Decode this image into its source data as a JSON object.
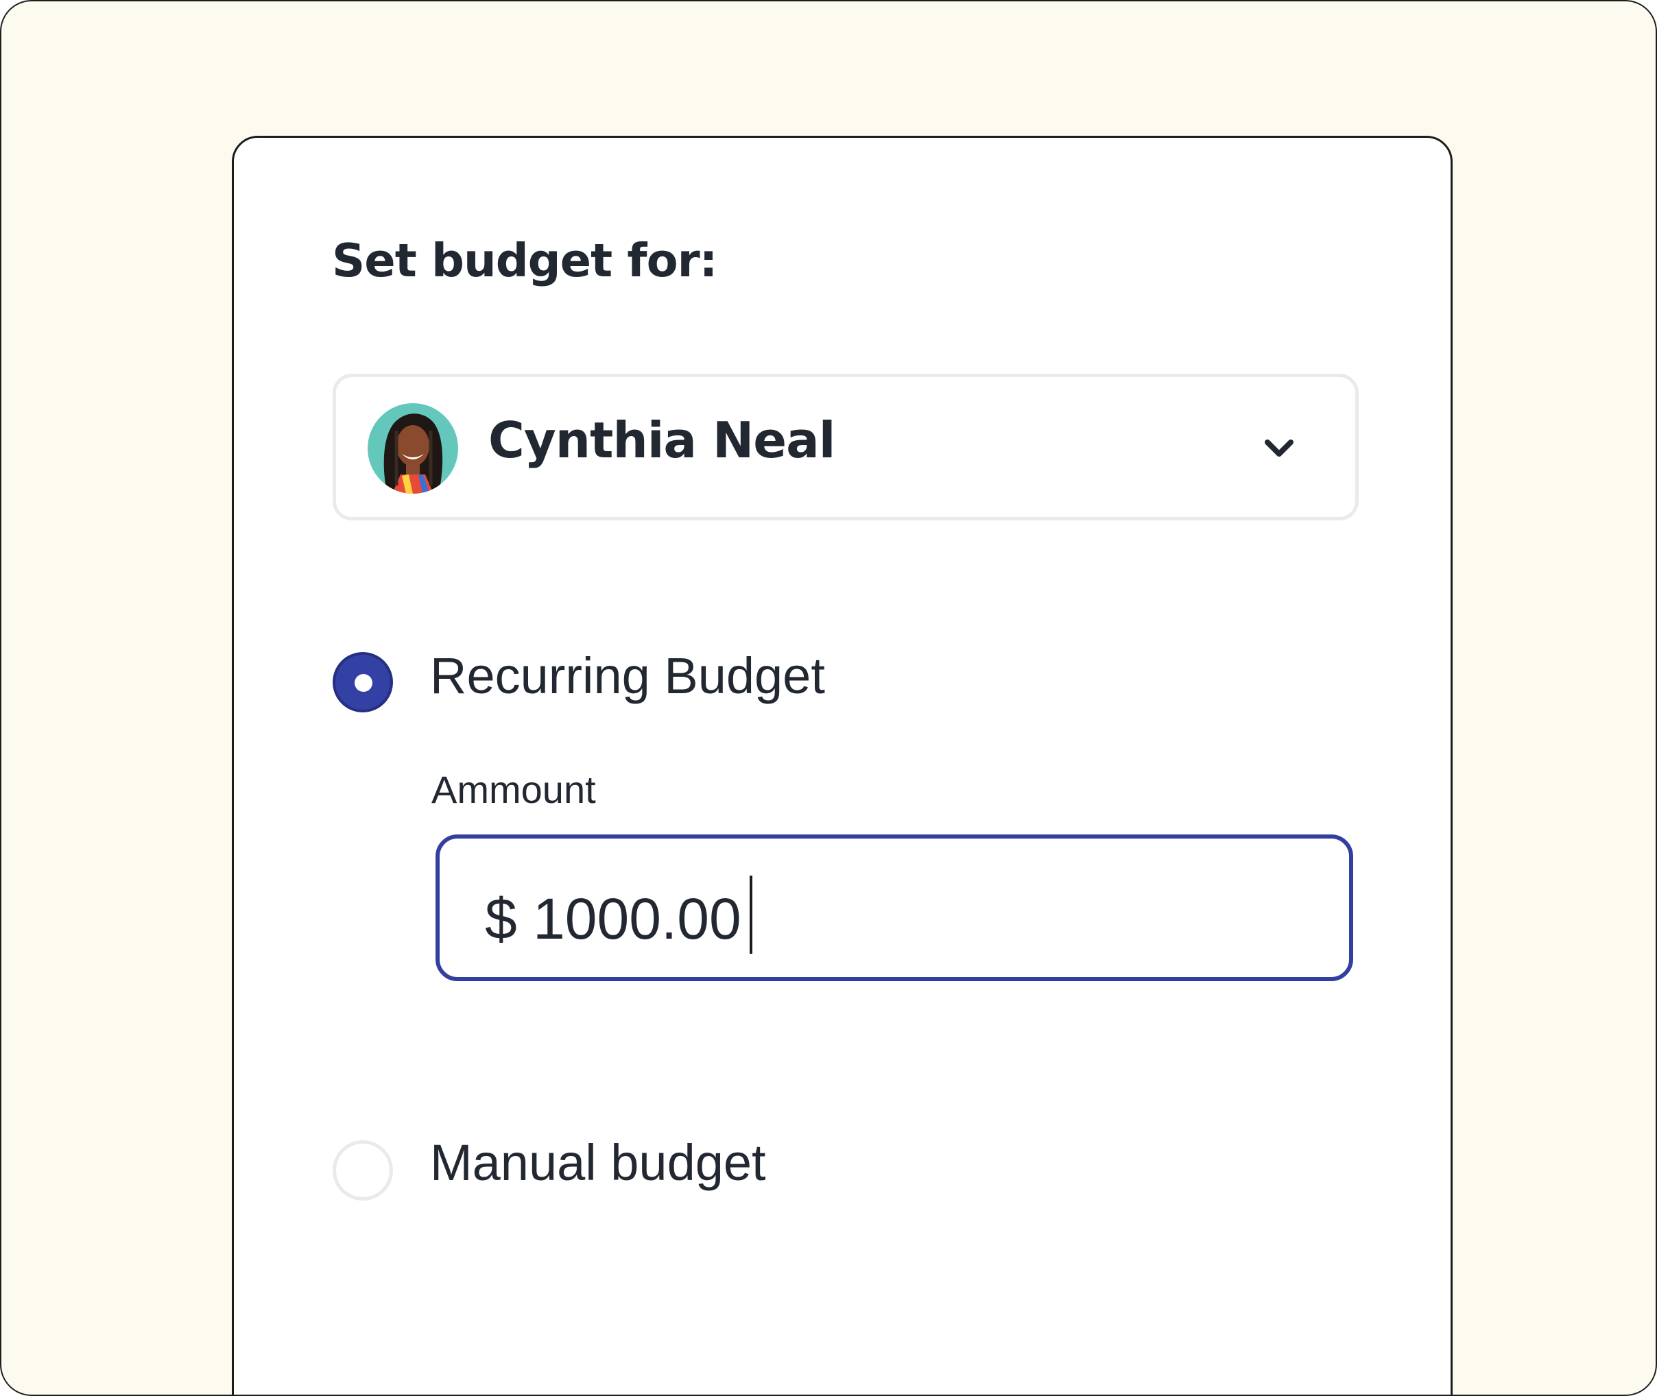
{
  "form": {
    "title": "Set budget for:",
    "selected_person": {
      "name": "Cynthia Neal",
      "avatar_icon": "profile-photo",
      "dropdown_icon": "chevron-down-icon"
    },
    "options": [
      {
        "label": "Recurring Budget",
        "selected": true
      },
      {
        "label": "Manual budget",
        "selected": false
      }
    ],
    "amount": {
      "label": "Ammount",
      "currency_symbol": "$",
      "value": "1000.00"
    }
  },
  "colors": {
    "page_background": "#fdfbf0",
    "card_background": "#ffffff",
    "accent": "#3340a4",
    "text": "#222831",
    "border_light": "#e8ebeb"
  }
}
